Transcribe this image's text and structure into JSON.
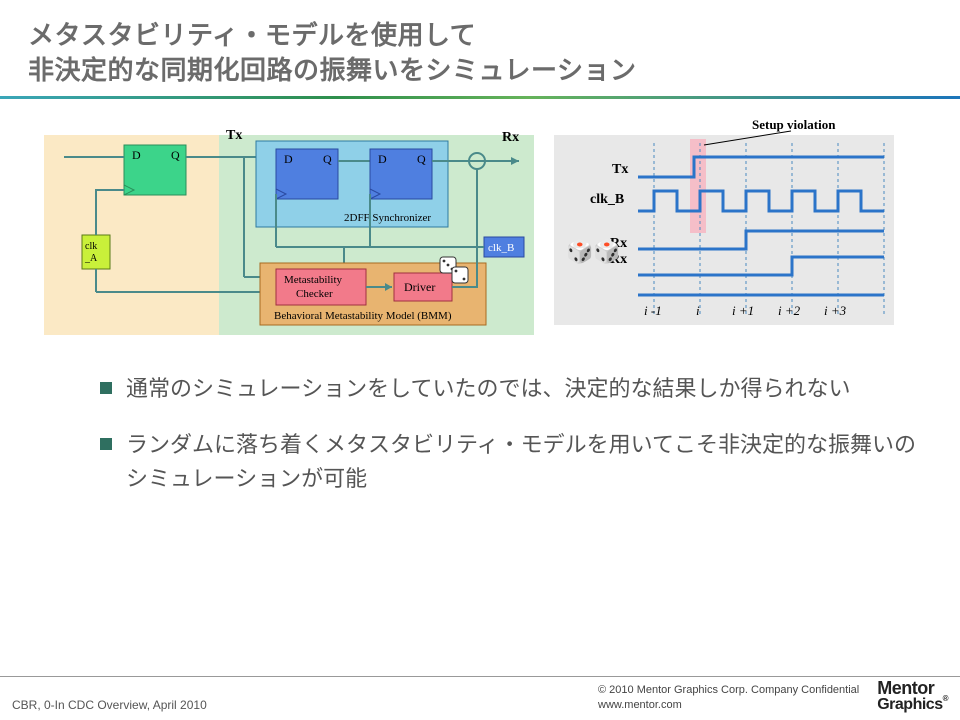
{
  "title_line1": "メタスタビリティ・モデルを使用して",
  "title_line2": "非決定的な同期化回路の振舞いをシミュレーション",
  "block_diagram": {
    "labels": {
      "Tx": "Tx",
      "Rx": "Rx",
      "D": "D",
      "Q": "Q",
      "clk_A": "clk_A",
      "clk_B": "clk_B",
      "sync": "2DFF Synchronizer",
      "metachecker_l1": "Metastability",
      "metachecker_l2": "Checker",
      "driver": "Driver",
      "bmm": "Behavioral Metastability Model (BMM)"
    }
  },
  "timing": {
    "title": "Setup violation",
    "signals": [
      "Tx",
      "clk_B",
      "Rx",
      "Rx"
    ],
    "ticks": [
      "i -1",
      "i",
      "i +1",
      "i +2",
      "i +3"
    ],
    "dice": "🎲🎲"
  },
  "bullets": [
    "通常のシミュレーションをしていたのでは、決定的な結果しか得られない",
    "ランダムに落ち着くメタスタビリティ・モデルを用いてこそ非決定的な振舞いのシミュレーションが可能"
  ],
  "footer": {
    "left": "CBR, 0-In CDC Overview, April 2010",
    "legal_line1": "© 2010 Mentor Graphics Corp. Company Confidential",
    "legal_line2": "www.mentor.com",
    "logo_top": "Mentor",
    "logo_bottom": "Graphics",
    "logo_reg": "®"
  }
}
